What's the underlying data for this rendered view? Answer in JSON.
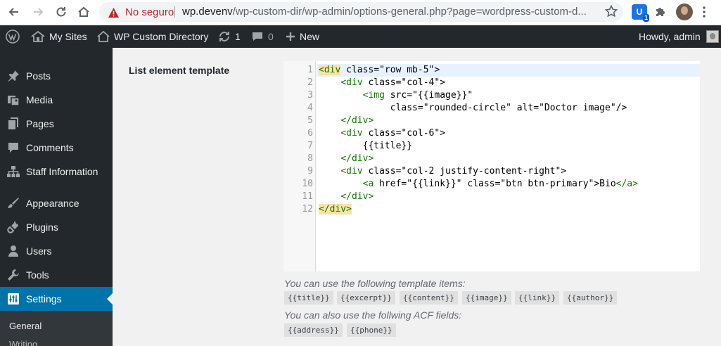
{
  "browser": {
    "security_label": "No seguro",
    "url_host": "wp.devenv",
    "url_path": "/wp-custom-dir/wp-admin/options-general.php?page=wordpress-custom-d...",
    "extension_badge": "1"
  },
  "admin_bar": {
    "my_sites": "My Sites",
    "site_name": "WP Custom Directory",
    "updates_count": "1",
    "comments_count": "0",
    "new_label": "New",
    "howdy": "Howdy, admin"
  },
  "sidebar": {
    "items": [
      {
        "label": "Posts",
        "icon": "pushpin-icon"
      },
      {
        "label": "Media",
        "icon": "media-icon"
      },
      {
        "label": "Pages",
        "icon": "pages-icon"
      },
      {
        "label": "Comments",
        "icon": "comments-icon"
      },
      {
        "label": "Staff Information",
        "icon": "hierarchy-icon"
      },
      {
        "label": "Appearance",
        "icon": "paintbrush-icon"
      },
      {
        "label": "Plugins",
        "icon": "plugin-icon"
      },
      {
        "label": "Users",
        "icon": "users-icon"
      },
      {
        "label": "Tools",
        "icon": "wrench-icon"
      },
      {
        "label": "Settings",
        "icon": "settings-icon",
        "current": true
      }
    ],
    "submenu": [
      "General",
      "Writing"
    ]
  },
  "main": {
    "field_label": "List element template",
    "editor": {
      "line_numbers": [
        "1",
        "2",
        "3",
        "4",
        "5",
        "6",
        "7",
        "8",
        "9",
        "10",
        "11",
        "12"
      ],
      "lines": [
        "<div class=\"row mb-5\">",
        "    <div class=\"col-4\">",
        "        <img src=\"{{image}}\"",
        "             class=\"rounded-circle\" alt=\"Doctor image\"/>",
        "    </div>",
        "    <div class=\"col-6\">",
        "        {{title}}",
        "    </div>",
        "    <div class=\"col-2 justify-content-right\">",
        "        <a href=\"{{link}}\" class=\"btn btn-primary\">Bio</a>",
        "    </div>",
        "</div>"
      ]
    },
    "template_items_hint": "You can use the following template items:",
    "template_items": [
      "{{title}}",
      "{{excerpt}}",
      "{{content}}",
      "{{image}}",
      "{{link}}",
      "{{author}}"
    ],
    "acf_hint": "You can also use the follwing ACF fields:",
    "acf_fields": [
      "{{address}}",
      "{{phone}}"
    ]
  },
  "colors": {
    "admin_bar_bg": "#23282d",
    "sidebar_bg": "#23282d",
    "current_menu_bg": "#0073aa",
    "insecure_red": "#c5221f"
  }
}
